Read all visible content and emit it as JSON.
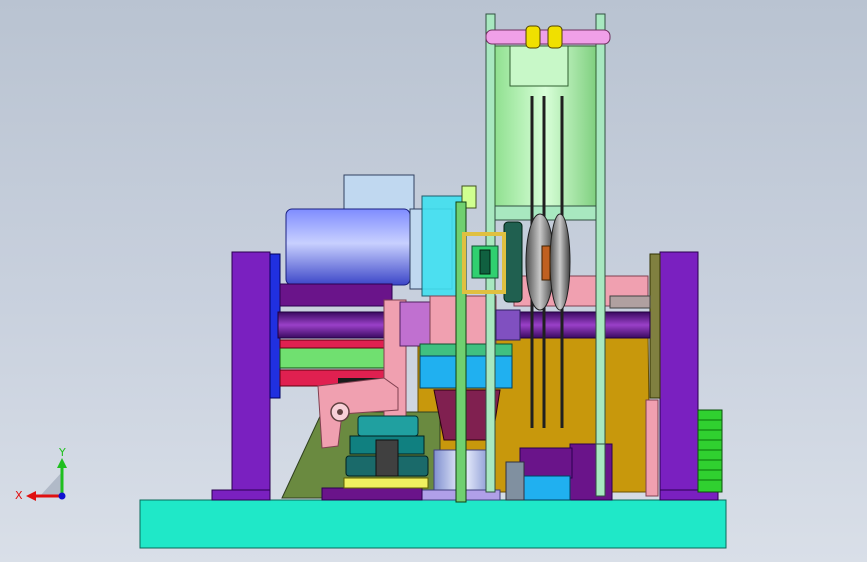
{
  "viewport": {
    "background_top": "#b9c3d1",
    "background_bottom": "#d9dfe8"
  },
  "triad": {
    "y_label": "Y",
    "x_label": "X",
    "y_color": "#1fbf1f",
    "x_color": "#e01010",
    "z_color": "#1010d0"
  },
  "palette": {
    "base": "#1fe8c8",
    "frame": "#7a20c0",
    "motor": "#5a64e8",
    "motor_box": "#c0d8f0",
    "shaft": "#6a148a",
    "column": "#a8e8c0",
    "cylinder": "#a8f0a8",
    "gold_plate": "#c8980c",
    "pink": "#f0a0b0",
    "cyan_block": "#20b0f0",
    "green_bar": "#70e070",
    "red_bar": "#e02050",
    "olive_plate": "#6a8a40",
    "gear": "#20a0a0",
    "yellow_roller": "#f0e000",
    "side_fan": "#30d030"
  }
}
